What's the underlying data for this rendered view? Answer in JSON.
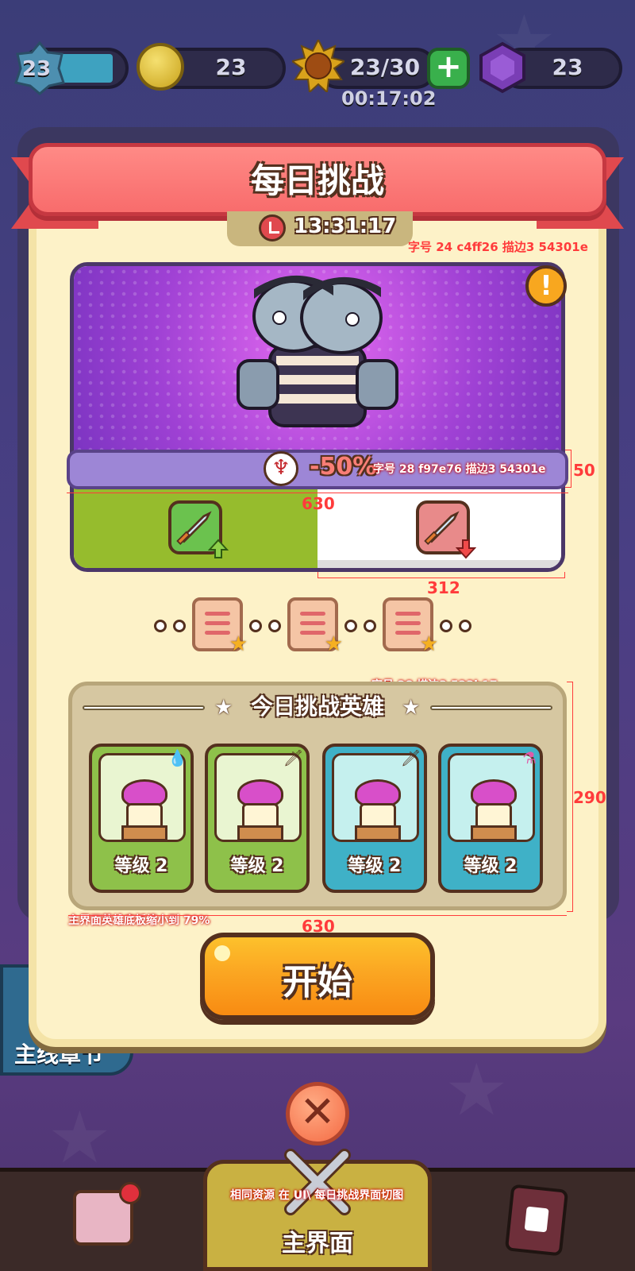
{
  "top_bar": {
    "player_level": "23",
    "coins": "23",
    "energy": "23/30",
    "energy_timer": "00:17:02",
    "gems": "23",
    "add_energy_label": "+"
  },
  "dialog": {
    "title": "每日挑战",
    "countdown": "13:31:17",
    "boss_debuff_pct": "-50%",
    "alert_label": "!",
    "heroes_title": "今日挑战英雄",
    "heroes": [
      {
        "level_label": "等级 2",
        "tag_icon": "water-drop-icon",
        "tag_glyph": "💧"
      },
      {
        "level_label": "等级 2",
        "tag_icon": "sword-icon",
        "tag_glyph": "🗡"
      },
      {
        "level_label": "等级 2",
        "tag_icon": "sword-icon",
        "tag_glyph": "🗡"
      },
      {
        "level_label": "等级 2",
        "tag_icon": "potion-flask-icon",
        "tag_glyph": "⚗"
      }
    ],
    "start_label": "开始"
  },
  "side": {
    "main_chapter_label": "主线章节"
  },
  "bottom_nav": {
    "main_label": "主界面"
  },
  "annotations": {
    "ribbon_note": "字号 24  c4ff26 描边3  54301e",
    "pct_note": "字号 28  f97e76  描边3  54301e",
    "bar_height": "50",
    "bar_width": "630",
    "half_width": "312",
    "heroes_title_note": "字号 28  描边3  523b17",
    "panel_height": "290",
    "panel_scale_note": "主界面英雄底板缩小到 79%",
    "panel_width": "630",
    "resource_note": "相同资源    在 UI\\ 每日挑战界面切图"
  },
  "colors": {
    "stroke": "#54301e",
    "pct_fill": "#f97e76",
    "ribbon": "#f86c6c",
    "start": "#fba622"
  }
}
